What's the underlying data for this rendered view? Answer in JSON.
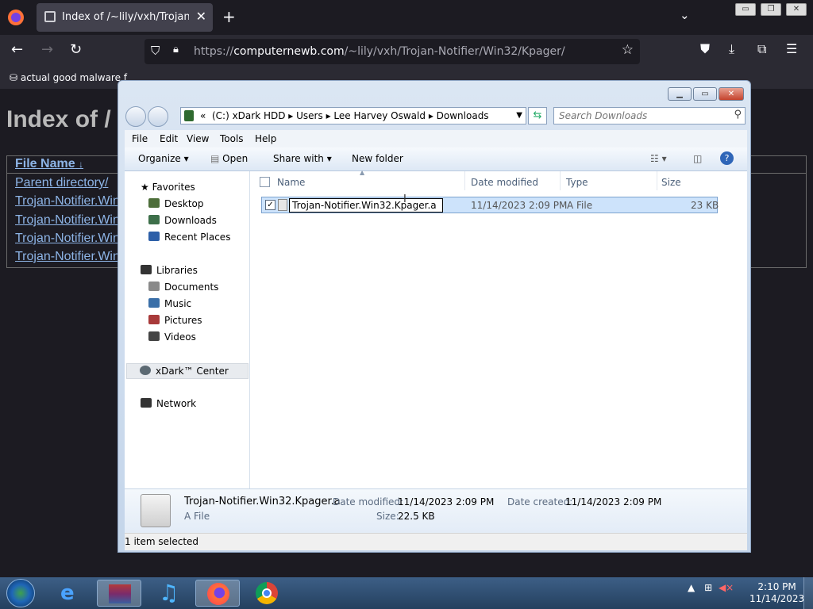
{
  "browser": {
    "tab_title": "Index of /~lily/vxh/Trojan-Notifier",
    "tab_close": "✕",
    "new_tab": "+",
    "tab_list": "⌄",
    "url_prefix": "https://",
    "url_host": "computernewb.com",
    "url_path": "/~lily/vxh/Trojan-Notifier/Win32/Kpager/",
    "bookmark": "actual good malware f",
    "win_minimize": "▭",
    "win_restore": "❐",
    "win_close": "✕"
  },
  "page": {
    "title": "Index of /",
    "header_link": "File Name",
    "sort_arrow": "↓",
    "links": [
      "Parent directory/",
      "Trojan-Notifier.Win",
      "Trojan-Notifier.Win",
      "Trojan-Notifier.Win",
      "Trojan-Notifier.Win"
    ]
  },
  "explorer": {
    "breadcrumb": [
      "«",
      "(C:) xDark HDD",
      "Users",
      "Lee Harvey Oswald",
      "Downloads"
    ],
    "search_placeholder": "Search Downloads",
    "menus": [
      "File",
      "Edit",
      "View",
      "Tools",
      "Help"
    ],
    "toolbar": {
      "organize": "Organize ▾",
      "open": "Open",
      "share": "Share with ▾",
      "new_folder": "New folder"
    },
    "nav": {
      "favorites": "Favorites",
      "favorites_items": [
        "Desktop",
        "Downloads",
        "Recent Places"
      ],
      "libraries": "Libraries",
      "libraries_items": [
        "Documents",
        "Music",
        "Pictures",
        "Videos"
      ],
      "xdark": "xDark™ Center",
      "network": "Network"
    },
    "columns": [
      "Name",
      "Date modified",
      "Type",
      "Size"
    ],
    "file": {
      "name": "Trojan-Notifier.Win32.Kpager.a",
      "date": "11/14/2023 2:09 PM",
      "type": "A File",
      "size": "23 KB"
    },
    "details": {
      "name": "Trojan-Notifier.Win32.Kpager.a",
      "type": "A File",
      "date_modified_label": "Date modified:",
      "date_modified": "11/14/2023 2:09 PM",
      "date_created_label": "Date created:",
      "date_created": "11/14/2023 2:09 PM",
      "size_label": "Size:",
      "size": "22.5 KB"
    },
    "status": "1 item selected"
  },
  "taskbar": {
    "time": "2:10 PM",
    "date": "11/14/2023",
    "apps": [
      "start-orb",
      "internet-explorer",
      "winrar",
      "itunes",
      "firefox",
      "chrome"
    ]
  }
}
